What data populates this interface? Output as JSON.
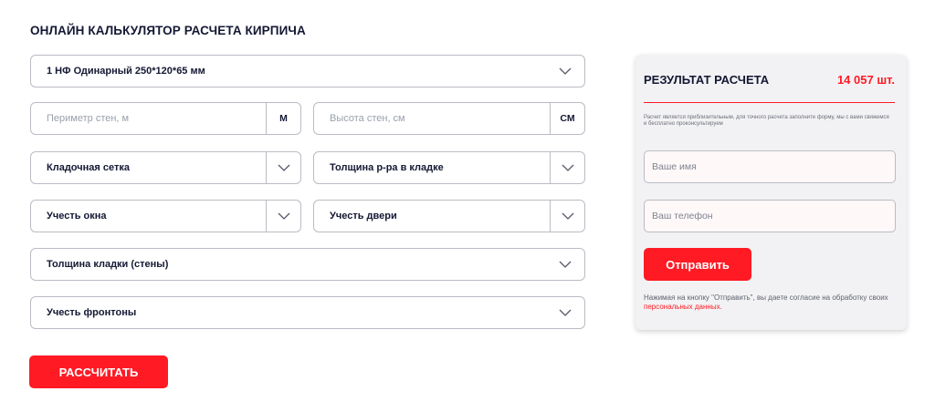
{
  "calculator": {
    "title": "ОНЛАЙН КАЛЬКУЛЯТОР РАСЧЕТА КИРПИЧА",
    "brick_type": "1 НФ Одинарный 250*120*65 мм",
    "perimeter": {
      "placeholder": "Периметр стен, м",
      "unit": "М"
    },
    "height": {
      "placeholder": "Высота стен, см",
      "unit": "СМ"
    },
    "mesh": "Кладочная сетка",
    "mortar": "Толщина р-ра в кладке",
    "windows": "Учесть окна",
    "doors": "Учесть двери",
    "wall_thickness": "Толщина кладки (стены)",
    "gables": "Учесть фронтоны",
    "calculate_button": "РАССЧИТАТЬ"
  },
  "result": {
    "title": "РЕЗУЛЬТАТ РАСЧЕТА",
    "count": "14 057 шт.",
    "note": "Расчет является приблизительным, для точного расчета заполните форму, мы с вами свяжемся и бесплатно проконсультируем",
    "name_placeholder": "Ваше имя",
    "phone_placeholder": "Ваш телефон",
    "submit_button": "Отправить",
    "consent_text": "Нажимая на кнопку \"Отправить\", вы даете согласие на обработку своих ",
    "consent_link": "персональных данных."
  },
  "colors": {
    "accent": "#ff1a24",
    "text": "#141833",
    "border": "#b9bcc4",
    "panel_bg": "#f2f2f4"
  },
  "icons": {
    "dropdown": "chevron-down-icon"
  }
}
